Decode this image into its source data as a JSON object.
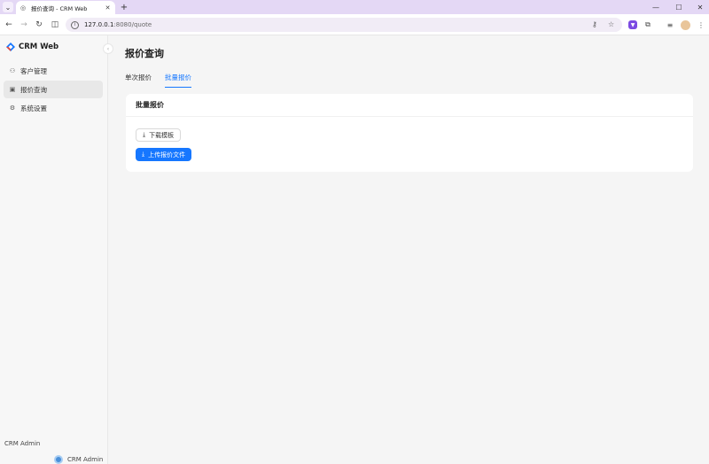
{
  "browser": {
    "tab_title": "报价查询 - CRM Web",
    "tab_close": "✕",
    "new_tab": "+",
    "url_host": "127.0.0.1",
    "url_rest": ":8080/quote",
    "icons": {
      "tab_menu": "chevron-down-icon",
      "favicon": "globe-icon",
      "back": "back-arrow-icon",
      "forward": "forward-arrow-icon",
      "reload": "reload-icon",
      "split": "split-view-icon",
      "info": "info-icon",
      "key": "key-icon",
      "star": "star-icon",
      "extension": "extension-icon",
      "puzzle": "puzzle-icon",
      "media": "media-icon",
      "profile": "profile-avatar",
      "menu": "kebab-menu-icon"
    }
  },
  "app": {
    "logo_text": "CRM Web",
    "brand_color": "#1677ff",
    "sidebar": {
      "items": [
        {
          "label": "客户管理",
          "icon": "users-icon",
          "active": false
        },
        {
          "label": "报价查询",
          "icon": "quote-icon",
          "active": true
        },
        {
          "label": "系统设置",
          "icon": "gear-icon",
          "active": false
        }
      ],
      "user_label": "CRM Admin",
      "user_name": "CRM Admin"
    },
    "page": {
      "title": "报价查询",
      "tabs": [
        {
          "label": "单次报价",
          "active": false
        },
        {
          "label": "批量报价",
          "active": true
        }
      ],
      "card": {
        "title": "批量报价",
        "download_label": "下载模板",
        "upload_label": "上传报价文件"
      }
    }
  }
}
